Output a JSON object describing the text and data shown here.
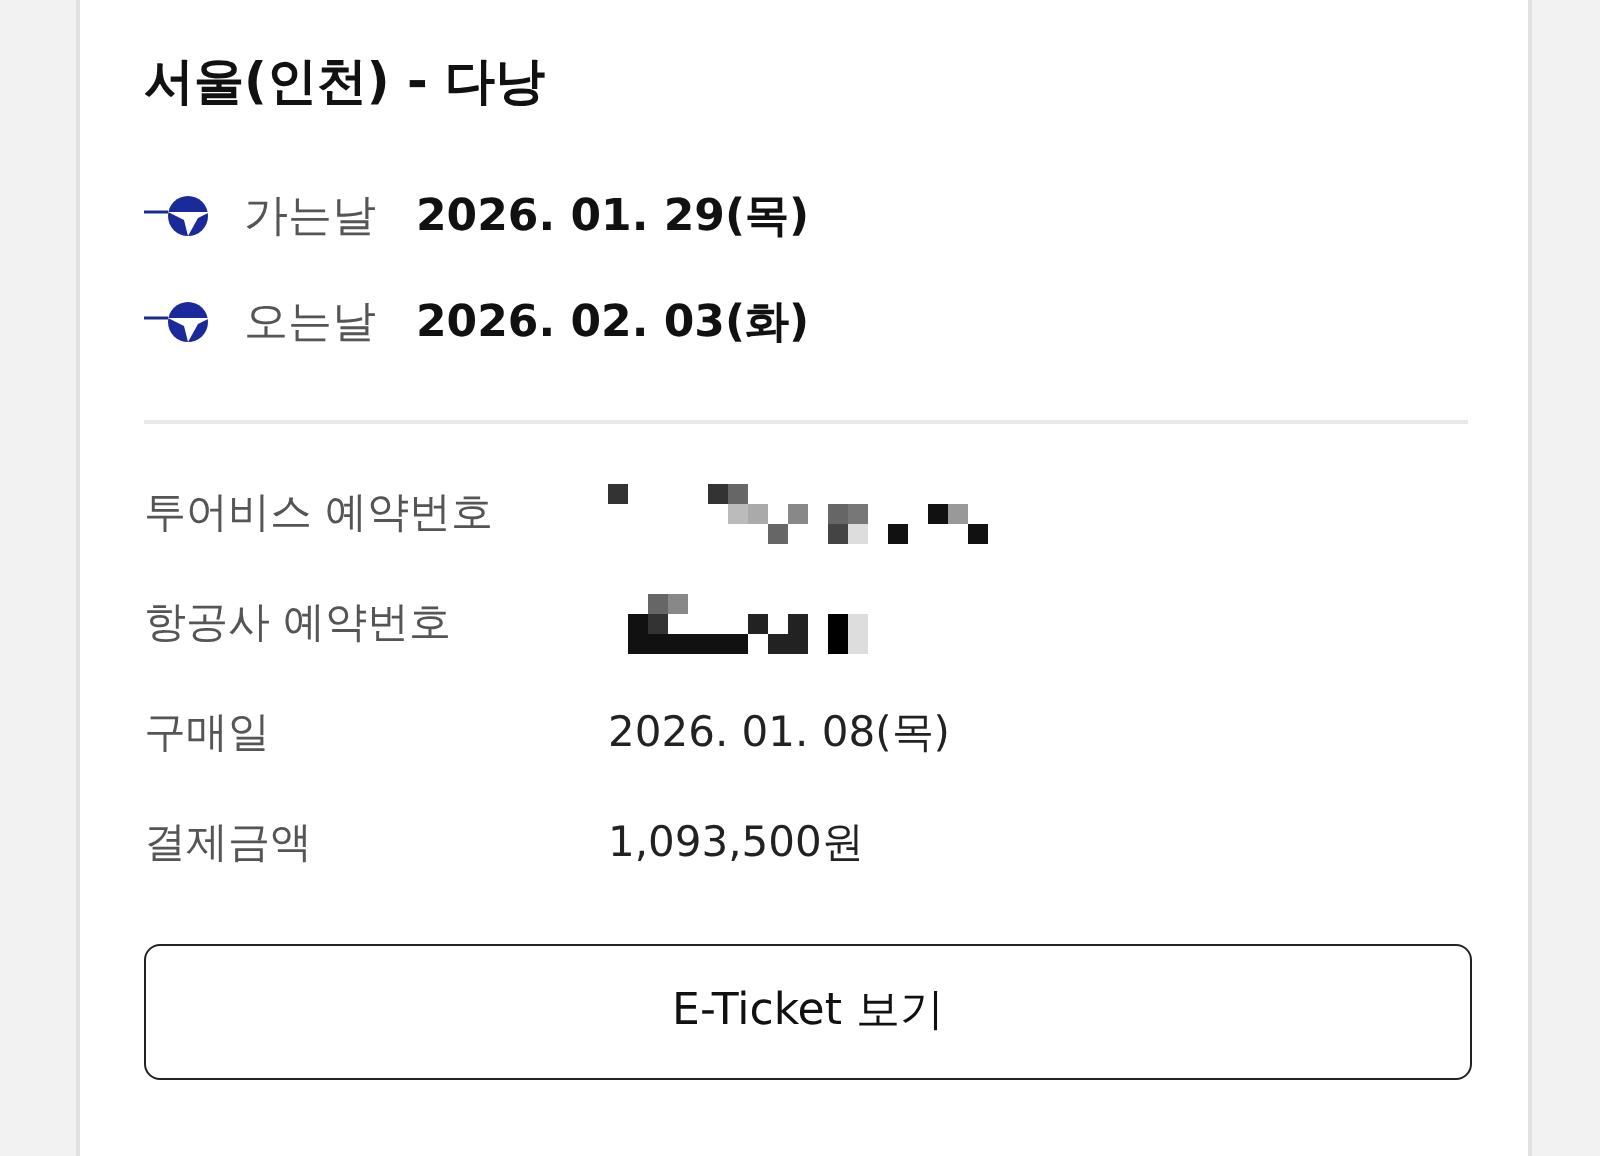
{
  "title": "서울(인천) - 다낭",
  "flights": [
    {
      "label": "가는날",
      "date": "2026. 01. 29(목)"
    },
    {
      "label": "오는날",
      "date": "2026. 02. 03(화)"
    }
  ],
  "details": [
    {
      "label": "투어비스 예약번호",
      "kind": "redacted"
    },
    {
      "label": "항공사 예약번호",
      "kind": "redacted"
    },
    {
      "label": "구매일",
      "kind": "text",
      "value": "2026. 01. 08(목)"
    },
    {
      "label": "결제금액",
      "kind": "text",
      "value": "1,093,500원"
    }
  ],
  "button": "E-Ticket 보기"
}
